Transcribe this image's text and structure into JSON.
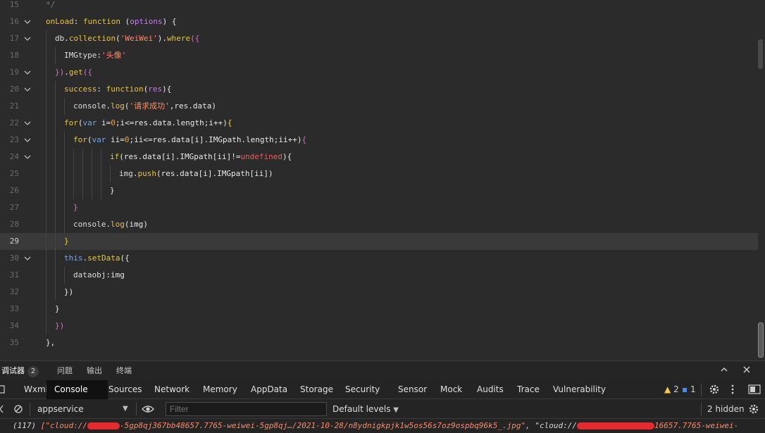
{
  "editor": {
    "lines": [
      {
        "n": "15",
        "fold": false,
        "indent": 1,
        "tokens": [
          [
            "cm",
            "*/"
          ]
        ]
      },
      {
        "n": "16",
        "fold": true,
        "indent": 1,
        "tokens": [
          [
            "fn",
            "onLoad"
          ],
          [
            "op",
            ": "
          ],
          [
            "kw",
            "function"
          ],
          [
            "op",
            " ("
          ],
          [
            "param",
            "options"
          ],
          [
            "op",
            ") {"
          ]
        ]
      },
      {
        "n": "17",
        "fold": true,
        "indent": 2,
        "tokens": [
          [
            "prop",
            "db"
          ],
          [
            "op",
            "."
          ],
          [
            "fn",
            "collection"
          ],
          [
            "op",
            "("
          ],
          [
            "str",
            "'WeiWei'"
          ],
          [
            "op",
            ")."
          ],
          [
            "fn",
            "where"
          ],
          [
            "pink",
            "({"
          ]
        ]
      },
      {
        "n": "18",
        "fold": false,
        "indent": 3,
        "tokens": [
          [
            "prop",
            "IMGtype"
          ],
          [
            "op",
            ":"
          ],
          [
            "str",
            "'头像'"
          ]
        ]
      },
      {
        "n": "19",
        "fold": true,
        "indent": 2,
        "tokens": [
          [
            "pink",
            "})"
          ],
          [
            "op",
            "."
          ],
          [
            "fn",
            "get"
          ],
          [
            "pink",
            "({"
          ]
        ]
      },
      {
        "n": "20",
        "fold": true,
        "indent": 3,
        "tokens": [
          [
            "fn",
            "success"
          ],
          [
            "op",
            ": "
          ],
          [
            "kw",
            "function"
          ],
          [
            "op",
            "("
          ],
          [
            "param",
            "res"
          ],
          [
            "op",
            "){"
          ]
        ]
      },
      {
        "n": "21",
        "fold": false,
        "indent": 4,
        "tokens": [
          [
            "prop",
            "console"
          ],
          [
            "op",
            "."
          ],
          [
            "fn",
            "log"
          ],
          [
            "op",
            "("
          ],
          [
            "str",
            "'请求成功'"
          ],
          [
            "op",
            ",res.data)"
          ]
        ]
      },
      {
        "n": "22",
        "fold": true,
        "indent": 3,
        "tokens": [
          [
            "kw",
            "for"
          ],
          [
            "op",
            "("
          ],
          [
            "blue",
            "var"
          ],
          [
            "op",
            " i="
          ],
          [
            "num",
            "0"
          ],
          [
            "op",
            ";i<=res.data.length;i++)"
          ],
          [
            "yellowb",
            "{"
          ]
        ]
      },
      {
        "n": "23",
        "fold": true,
        "indent": 4,
        "tokens": [
          [
            "kw",
            "for"
          ],
          [
            "op",
            "("
          ],
          [
            "blue",
            "var"
          ],
          [
            "op",
            " ii="
          ],
          [
            "num",
            "0"
          ],
          [
            "op",
            ";ii<=res.data[i].IMGpath.length;ii++)"
          ],
          [
            "pink",
            "{"
          ]
        ]
      },
      {
        "n": "24",
        "fold": true,
        "indent": 8,
        "tokens": [
          [
            "kw",
            "if"
          ],
          [
            "op",
            "(res.data[i].IMGpath[ii]!="
          ],
          [
            "red",
            "undefined"
          ],
          [
            "op",
            "){"
          ]
        ]
      },
      {
        "n": "25",
        "fold": false,
        "indent": 9,
        "tokens": [
          [
            "prop",
            "img"
          ],
          [
            "op",
            "."
          ],
          [
            "fn",
            "push"
          ],
          [
            "op",
            "(res.data[i].IMGpath[ii])"
          ]
        ]
      },
      {
        "n": "26",
        "fold": false,
        "indent": 8,
        "tokens": [
          [
            "op",
            "}"
          ]
        ]
      },
      {
        "n": "27",
        "fold": false,
        "indent": 4,
        "tokens": [
          [
            "pink",
            "}"
          ]
        ]
      },
      {
        "n": "28",
        "fold": false,
        "indent": 4,
        "tokens": [
          [
            "prop",
            "console"
          ],
          [
            "op",
            "."
          ],
          [
            "fn",
            "log"
          ],
          [
            "op",
            "(img)"
          ]
        ]
      },
      {
        "n": "29",
        "fold": false,
        "indent": 3,
        "current": true,
        "tokens": [
          [
            "yellowb",
            "}"
          ]
        ]
      },
      {
        "n": "30",
        "fold": true,
        "indent": 3,
        "tokens": [
          [
            "blue",
            "this"
          ],
          [
            "op",
            "."
          ],
          [
            "fn",
            "setData"
          ],
          [
            "op",
            "({"
          ]
        ]
      },
      {
        "n": "31",
        "fold": false,
        "indent": 4,
        "tokens": [
          [
            "prop",
            "dataobj"
          ],
          [
            "op",
            ":img"
          ]
        ]
      },
      {
        "n": "32",
        "fold": false,
        "indent": 3,
        "tokens": [
          [
            "op",
            "})"
          ]
        ]
      },
      {
        "n": "33",
        "fold": false,
        "indent": 2,
        "tokens": [
          [
            "op",
            "}"
          ]
        ]
      },
      {
        "n": "34",
        "fold": false,
        "indent": 2,
        "tokens": [
          [
            "pink",
            "})"
          ]
        ]
      },
      {
        "n": "35",
        "fold": false,
        "indent": 1,
        "tokens": [
          [
            "op",
            "},"
          ]
        ]
      }
    ]
  },
  "panel": {
    "tabs": [
      {
        "label": "调试器",
        "badge": "2"
      },
      {
        "label": "问题"
      },
      {
        "label": "输出"
      },
      {
        "label": "终端"
      }
    ],
    "collapse_icon": "chevron-up-icon",
    "close_icon": "close-icon"
  },
  "devtools": {
    "tabs": [
      "Wxml",
      "Console",
      "Sources",
      "Network",
      "Memory",
      "AppData",
      "Storage",
      "Security",
      "Sensor",
      "Mock",
      "Audits",
      "Trace",
      "Vulnerability"
    ],
    "active": "Console",
    "warnings": "2",
    "messages": "1"
  },
  "console": {
    "context": "appservice",
    "filter_placeholder": "Filter",
    "levels": "Default levels",
    "hidden": "2 hidden",
    "log": {
      "count": "(117)",
      "part1": "[\"cloud://",
      "part2": "-5gp8qj367bb48657.7765-weiwei-5gp8qj…/2021-10-28/n8ydnigkpjk1w5os56s7oz9ospbq96k5_.jpg\"",
      "part3": ", \"cloud://",
      "part4": "16657.7765-weiwei-"
    }
  }
}
